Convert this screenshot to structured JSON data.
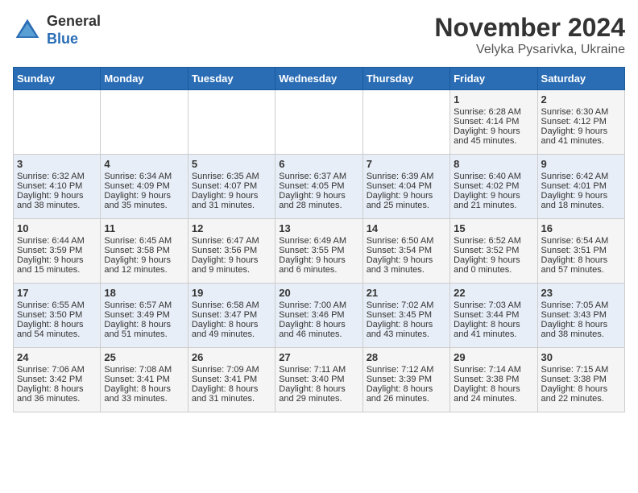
{
  "header": {
    "logo_general": "General",
    "logo_blue": "Blue",
    "month_year": "November 2024",
    "location": "Velyka Pysarivka, Ukraine"
  },
  "calendar": {
    "headers": [
      "Sunday",
      "Monday",
      "Tuesday",
      "Wednesday",
      "Thursday",
      "Friday",
      "Saturday"
    ],
    "rows": [
      [
        {
          "day": "",
          "lines": []
        },
        {
          "day": "",
          "lines": []
        },
        {
          "day": "",
          "lines": []
        },
        {
          "day": "",
          "lines": []
        },
        {
          "day": "",
          "lines": []
        },
        {
          "day": "1",
          "lines": [
            "Sunrise: 6:28 AM",
            "Sunset: 4:14 PM",
            "Daylight: 9 hours",
            "and 45 minutes."
          ]
        },
        {
          "day": "2",
          "lines": [
            "Sunrise: 6:30 AM",
            "Sunset: 4:12 PM",
            "Daylight: 9 hours",
            "and 41 minutes."
          ]
        }
      ],
      [
        {
          "day": "3",
          "lines": [
            "Sunrise: 6:32 AM",
            "Sunset: 4:10 PM",
            "Daylight: 9 hours",
            "and 38 minutes."
          ]
        },
        {
          "day": "4",
          "lines": [
            "Sunrise: 6:34 AM",
            "Sunset: 4:09 PM",
            "Daylight: 9 hours",
            "and 35 minutes."
          ]
        },
        {
          "day": "5",
          "lines": [
            "Sunrise: 6:35 AM",
            "Sunset: 4:07 PM",
            "Daylight: 9 hours",
            "and 31 minutes."
          ]
        },
        {
          "day": "6",
          "lines": [
            "Sunrise: 6:37 AM",
            "Sunset: 4:05 PM",
            "Daylight: 9 hours",
            "and 28 minutes."
          ]
        },
        {
          "day": "7",
          "lines": [
            "Sunrise: 6:39 AM",
            "Sunset: 4:04 PM",
            "Daylight: 9 hours",
            "and 25 minutes."
          ]
        },
        {
          "day": "8",
          "lines": [
            "Sunrise: 6:40 AM",
            "Sunset: 4:02 PM",
            "Daylight: 9 hours",
            "and 21 minutes."
          ]
        },
        {
          "day": "9",
          "lines": [
            "Sunrise: 6:42 AM",
            "Sunset: 4:01 PM",
            "Daylight: 9 hours",
            "and 18 minutes."
          ]
        }
      ],
      [
        {
          "day": "10",
          "lines": [
            "Sunrise: 6:44 AM",
            "Sunset: 3:59 PM",
            "Daylight: 9 hours",
            "and 15 minutes."
          ]
        },
        {
          "day": "11",
          "lines": [
            "Sunrise: 6:45 AM",
            "Sunset: 3:58 PM",
            "Daylight: 9 hours",
            "and 12 minutes."
          ]
        },
        {
          "day": "12",
          "lines": [
            "Sunrise: 6:47 AM",
            "Sunset: 3:56 PM",
            "Daylight: 9 hours",
            "and 9 minutes."
          ]
        },
        {
          "day": "13",
          "lines": [
            "Sunrise: 6:49 AM",
            "Sunset: 3:55 PM",
            "Daylight: 9 hours",
            "and 6 minutes."
          ]
        },
        {
          "day": "14",
          "lines": [
            "Sunrise: 6:50 AM",
            "Sunset: 3:54 PM",
            "Daylight: 9 hours",
            "and 3 minutes."
          ]
        },
        {
          "day": "15",
          "lines": [
            "Sunrise: 6:52 AM",
            "Sunset: 3:52 PM",
            "Daylight: 9 hours",
            "and 0 minutes."
          ]
        },
        {
          "day": "16",
          "lines": [
            "Sunrise: 6:54 AM",
            "Sunset: 3:51 PM",
            "Daylight: 8 hours",
            "and 57 minutes."
          ]
        }
      ],
      [
        {
          "day": "17",
          "lines": [
            "Sunrise: 6:55 AM",
            "Sunset: 3:50 PM",
            "Daylight: 8 hours",
            "and 54 minutes."
          ]
        },
        {
          "day": "18",
          "lines": [
            "Sunrise: 6:57 AM",
            "Sunset: 3:49 PM",
            "Daylight: 8 hours",
            "and 51 minutes."
          ]
        },
        {
          "day": "19",
          "lines": [
            "Sunrise: 6:58 AM",
            "Sunset: 3:47 PM",
            "Daylight: 8 hours",
            "and 49 minutes."
          ]
        },
        {
          "day": "20",
          "lines": [
            "Sunrise: 7:00 AM",
            "Sunset: 3:46 PM",
            "Daylight: 8 hours",
            "and 46 minutes."
          ]
        },
        {
          "day": "21",
          "lines": [
            "Sunrise: 7:02 AM",
            "Sunset: 3:45 PM",
            "Daylight: 8 hours",
            "and 43 minutes."
          ]
        },
        {
          "day": "22",
          "lines": [
            "Sunrise: 7:03 AM",
            "Sunset: 3:44 PM",
            "Daylight: 8 hours",
            "and 41 minutes."
          ]
        },
        {
          "day": "23",
          "lines": [
            "Sunrise: 7:05 AM",
            "Sunset: 3:43 PM",
            "Daylight: 8 hours",
            "and 38 minutes."
          ]
        }
      ],
      [
        {
          "day": "24",
          "lines": [
            "Sunrise: 7:06 AM",
            "Sunset: 3:42 PM",
            "Daylight: 8 hours",
            "and 36 minutes."
          ]
        },
        {
          "day": "25",
          "lines": [
            "Sunrise: 7:08 AM",
            "Sunset: 3:41 PM",
            "Daylight: 8 hours",
            "and 33 minutes."
          ]
        },
        {
          "day": "26",
          "lines": [
            "Sunrise: 7:09 AM",
            "Sunset: 3:41 PM",
            "Daylight: 8 hours",
            "and 31 minutes."
          ]
        },
        {
          "day": "27",
          "lines": [
            "Sunrise: 7:11 AM",
            "Sunset: 3:40 PM",
            "Daylight: 8 hours",
            "and 29 minutes."
          ]
        },
        {
          "day": "28",
          "lines": [
            "Sunrise: 7:12 AM",
            "Sunset: 3:39 PM",
            "Daylight: 8 hours",
            "and 26 minutes."
          ]
        },
        {
          "day": "29",
          "lines": [
            "Sunrise: 7:14 AM",
            "Sunset: 3:38 PM",
            "Daylight: 8 hours",
            "and 24 minutes."
          ]
        },
        {
          "day": "30",
          "lines": [
            "Sunrise: 7:15 AM",
            "Sunset: 3:38 PM",
            "Daylight: 8 hours",
            "and 22 minutes."
          ]
        }
      ]
    ]
  }
}
